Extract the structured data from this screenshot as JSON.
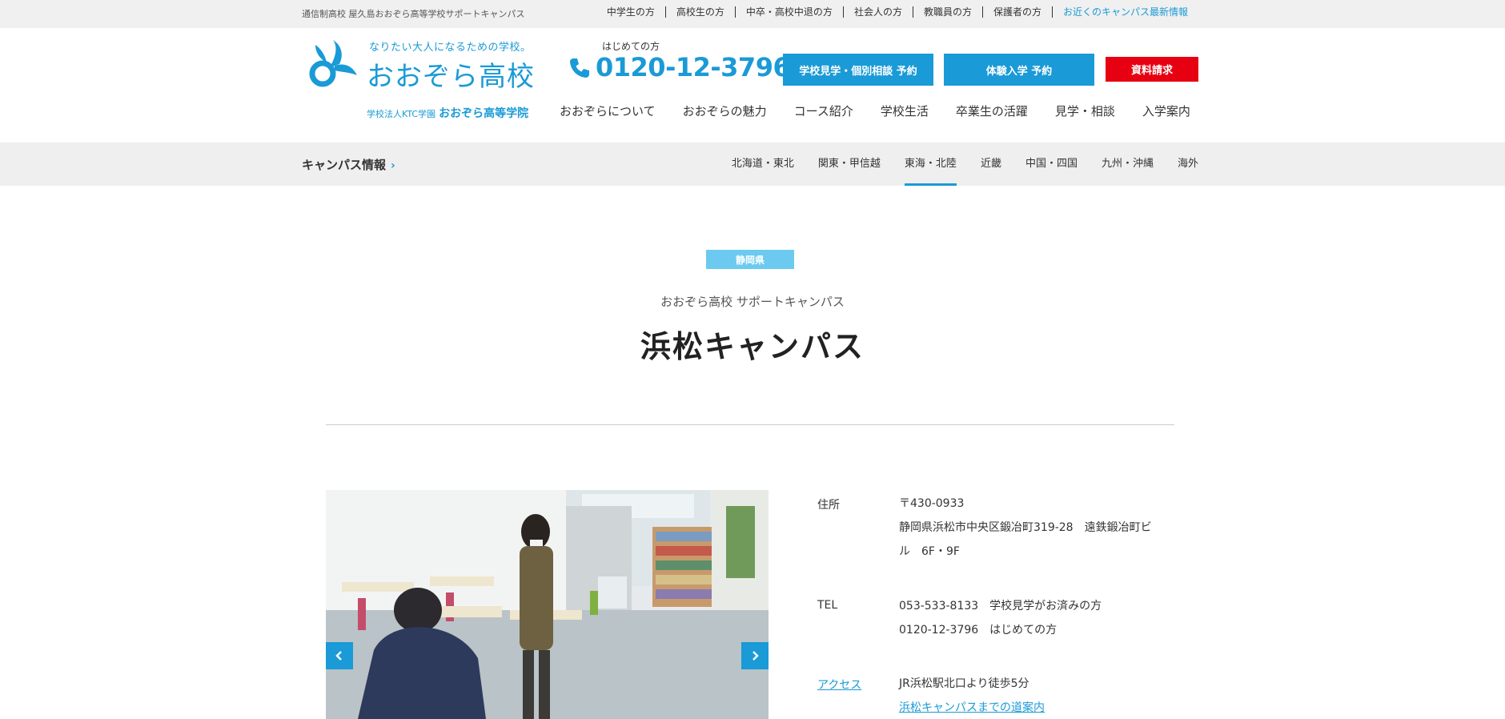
{
  "topbar": {
    "site_desc": "通信制高校 屋久島おおぞら高等学校サポートキャンパス",
    "links": [
      "中学生の方",
      "高校生の方",
      "中卒・高校中退の方",
      "社会人の方",
      "教職員の方",
      "保護者の方",
      "お近くのキャンパス最新情報"
    ]
  },
  "logo": {
    "tagline": "なりたい大人になるための学校。",
    "name": "おおぞら高校",
    "sub_prefix": "学校法人KTC学園",
    "sub_name": "おおぞら高等学院"
  },
  "phone": {
    "caption": "はじめての方",
    "number": "0120-12-3796"
  },
  "header_buttons": {
    "visit": "学校見学・個別相談 予約",
    "trial": "体験入学 予約",
    "docs": "資料請求"
  },
  "main_nav": [
    "おおぞらについて",
    "おおぞらの魅力",
    "コース紹介",
    "学校生活",
    "卒業生の活躍",
    "見学・相談",
    "入学案内"
  ],
  "campus_bar": {
    "title": "キャンパス情報",
    "chevron": "›",
    "regions": [
      "北海道・東北",
      "関東・甲信越",
      "東海・北陸",
      "近畿",
      "中国・四国",
      "九州・沖縄",
      "海外"
    ],
    "active_region": "東海・北陸"
  },
  "campus": {
    "prefecture": "静岡県",
    "subtitle": "おおぞら高校 サポートキャンパス",
    "title": "浜松キャンパス"
  },
  "info": {
    "address_label": "住所",
    "address_lines": [
      "〒430-0933",
      "静岡県浜松市中央区鍛冶町319-28　遠鉄鍛冶町ビ",
      "ル　6F・9F"
    ],
    "tel_label": "TEL",
    "tel_lines": [
      "053-533-8133　学校見学がお済みの方",
      "0120-12-3796　はじめての方"
    ],
    "access_label": "アクセス",
    "access_line": "JR浜松駅北口より徒歩5分",
    "access_link": "浜松キャンパスまでの道案内"
  },
  "colors": {
    "brand_blue": "#1a9ad6",
    "badge_blue": "#6ccaf0",
    "docs_red": "#e60012"
  },
  "icons": [
    "logo-mark-icon",
    "phone-icon",
    "chevron-right-icon",
    "arrow-left-icon",
    "arrow-right-icon"
  ]
}
